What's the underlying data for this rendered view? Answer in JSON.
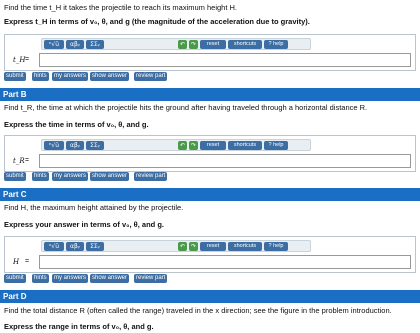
{
  "toolbar": {
    "sqrt_label": "ⁿ√ū",
    "greek_label": "αβᵧ",
    "sum_label": "ΣΣᵧ",
    "undo_icon": "undo-icon",
    "redo_icon": "redo-icon",
    "reset_label": "reset",
    "shortcuts_label": "shortcuts",
    "help_label": "? help"
  },
  "actions": {
    "submit": "submit",
    "hints": "hints",
    "my_answers": "my answers",
    "show_answer": "show answer",
    "review_part": "review part"
  },
  "part_a": {
    "question": "Find the time t_H it takes the projectile to reach its maximum height H.",
    "instruction": "Express t_H in terms of v₀, θ, and g (the magnitude of the acceleration due to gravity).",
    "var": "t_H",
    "eq": "="
  },
  "part_b": {
    "header": "Part B",
    "question": "Find t_R, the time at which the projectile hits the ground after having traveled through a horizontal distance R.",
    "instruction": "Express the time in terms of v₀, θ, and g.",
    "var": "t_R",
    "eq": "="
  },
  "part_c": {
    "header": "Part C",
    "question": "Find H, the maximum height attained by the projectile.",
    "instruction": "Express your answer in terms of v₀, θ, and g.",
    "var": "H",
    "eq": "="
  },
  "part_d": {
    "header": "Part D",
    "question": "Find the total distance R (often called the range) traveled in the x direction; see the figure in the problem introduction.",
    "instruction": "Express the range in terms of v₀, θ, and g."
  },
  "colors": {
    "header_blue": "#1a6fc4",
    "button_blue": "#3c6ea3",
    "icon_green": "#4a9a4a"
  }
}
